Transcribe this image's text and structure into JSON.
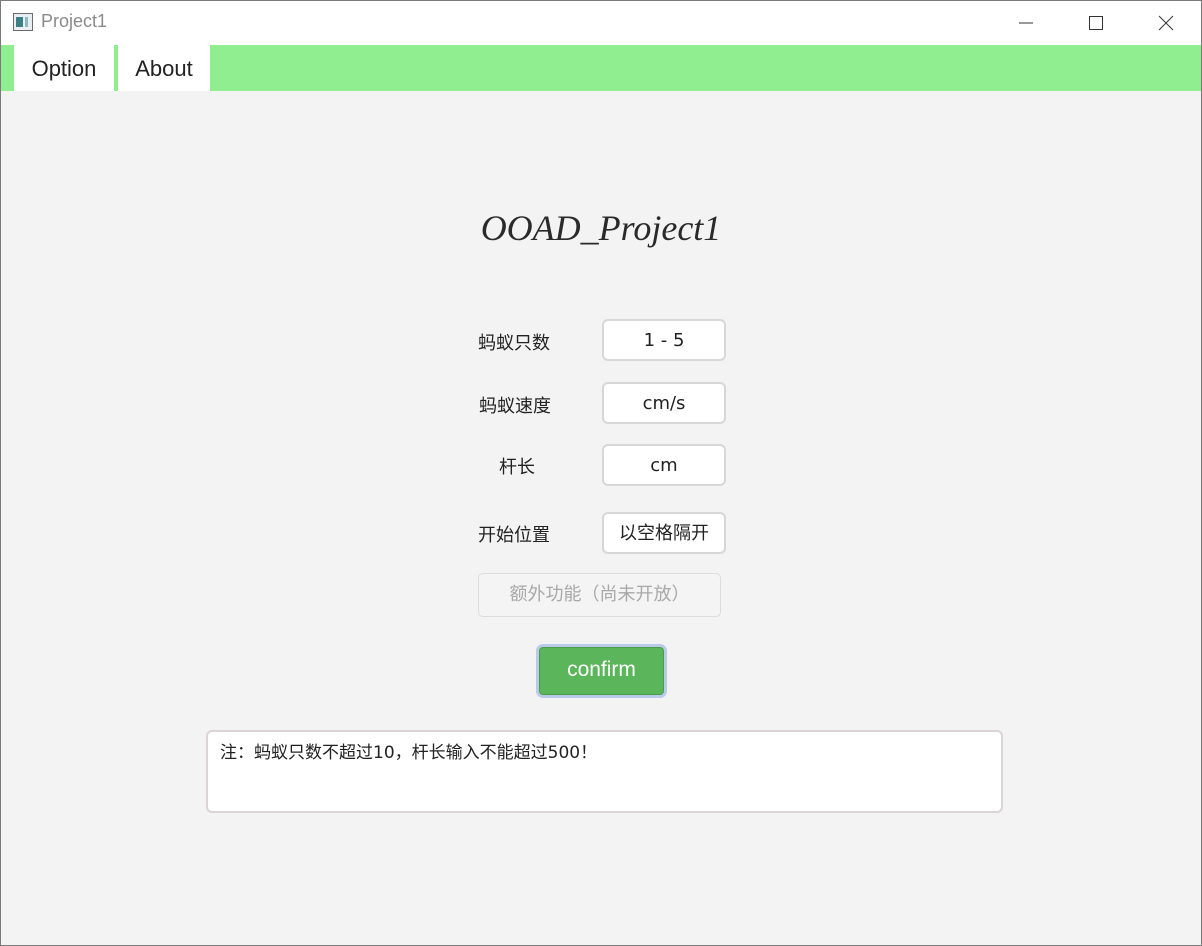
{
  "window": {
    "title": "Project1",
    "icon": "app-window-icon",
    "controls": [
      "minimize-icon",
      "maximize-icon",
      "close-icon"
    ]
  },
  "menu": {
    "items": [
      {
        "label": "Option"
      },
      {
        "label": "About"
      }
    ],
    "bar_color": "#90ee90"
  },
  "main": {
    "heading": "OOAD_Project1",
    "fields": [
      {
        "label": "蚂蚁只数",
        "placeholder": "1 - 5"
      },
      {
        "label": "蚂蚁速度",
        "placeholder": "cm/s"
      },
      {
        "label": "杆长",
        "placeholder": "cm"
      },
      {
        "label": "开始位置",
        "placeholder": "以空格隔开"
      }
    ],
    "extra_button": "额外功能（尚未开放）",
    "confirm_button": "confirm",
    "note": "注：蚂蚁只数不超过10，杆长输入不能超过500！"
  },
  "colors": {
    "confirm": "#5bb55b",
    "menu_bar": "#90ee90",
    "background": "#f3f3f3"
  }
}
